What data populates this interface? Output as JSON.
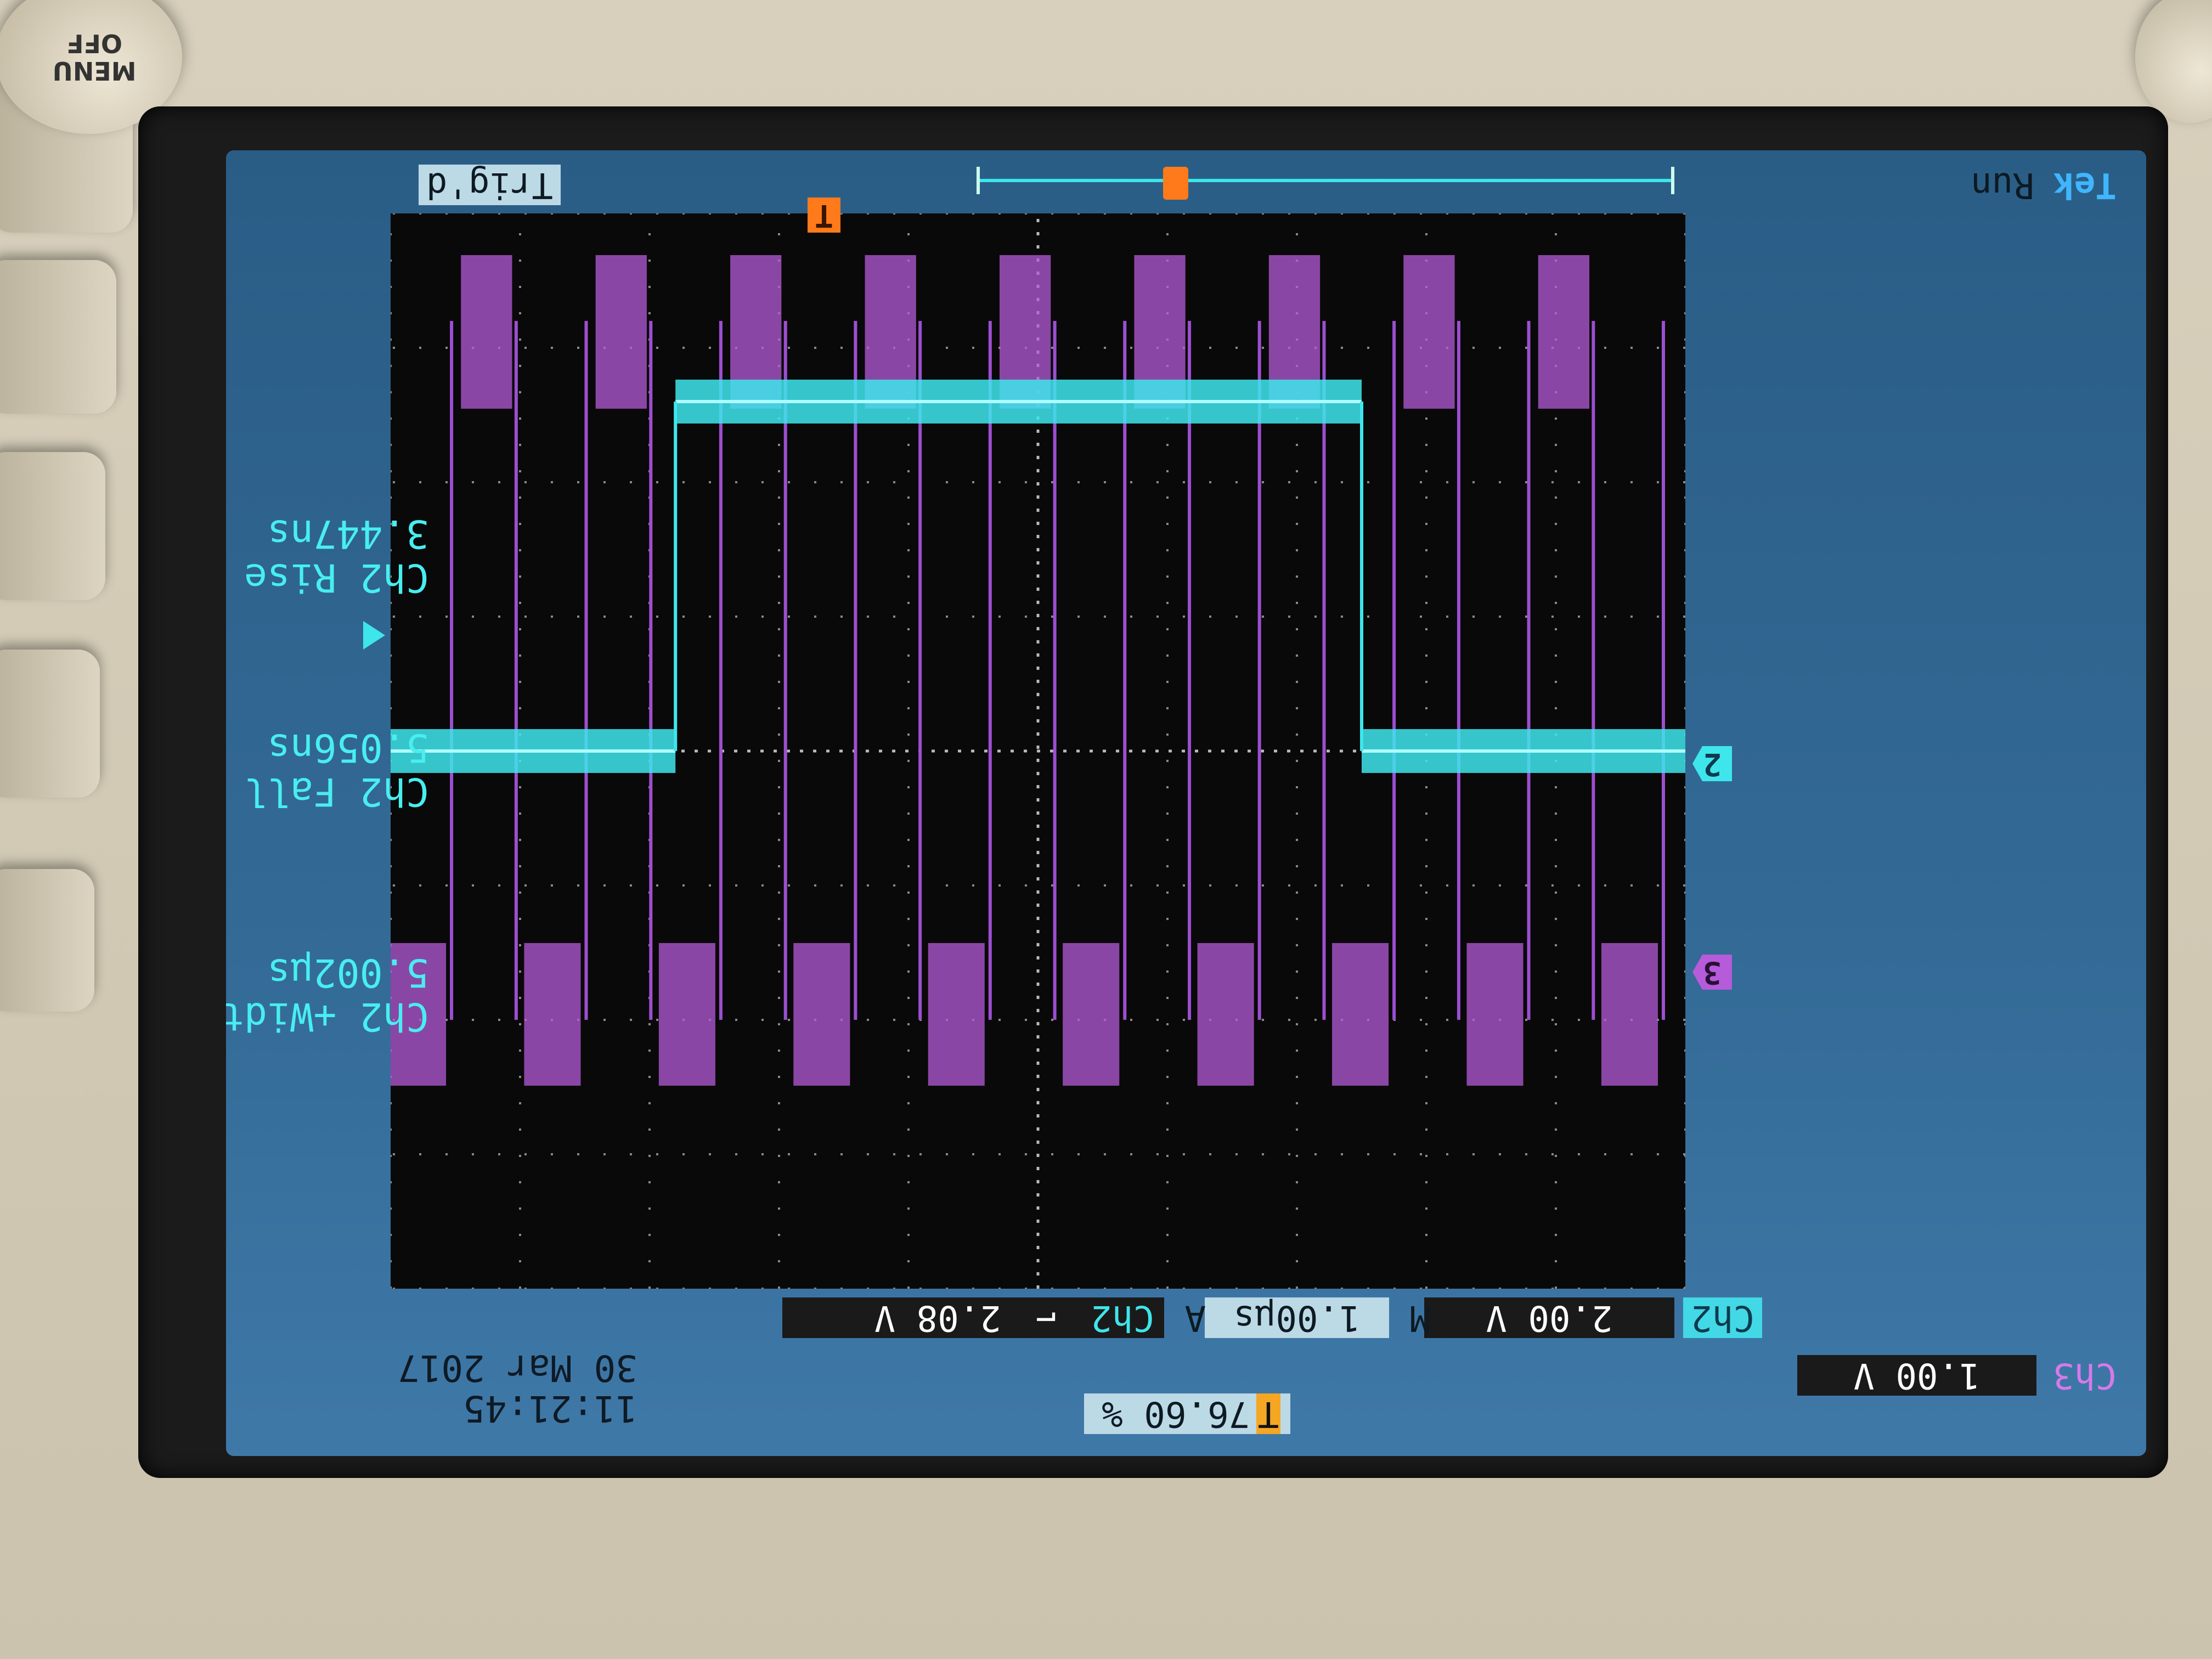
{
  "bezel": {
    "menu_off_label": "MENU\nOFF"
  },
  "header": {
    "date": "30 Mar 2017",
    "time": "11:21:45",
    "trigger_position": "76.60 %",
    "trigger_position_icon": "trigger-T-icon",
    "ch3_label": "Ch3",
    "ch3_scale": "1.00 V",
    "ch2_label": "Ch2",
    "ch2_scale": "2.00 V",
    "timebase_prefix": "M",
    "timebase": "1.00µs",
    "trigger_prefix": "A",
    "trigger_source": "Ch2",
    "trigger_slope_icon": "falling-edge-icon",
    "trigger_level": "2.08 V"
  },
  "measurements": [
    {
      "label": "Ch2 +Width",
      "value": "5.002µs"
    },
    {
      "label": "Ch2 Fall",
      "value": "5.056ns"
    },
    {
      "label": "Ch2 Rise",
      "value": "3.447ns"
    }
  ],
  "markers": {
    "ch3": "3",
    "ch2": "2",
    "trigger": "T"
  },
  "status": {
    "brand": "Tek",
    "run_state": "Run",
    "trigger_state": "Trig'd"
  },
  "colors": {
    "ch2": "#3ee6ec",
    "ch3": "#b65bd9",
    "trigger": "#ff7a1a",
    "screen_bg": "#336a96"
  },
  "chart_data": {
    "type": "line",
    "divisions_x": 10,
    "divisions_y": 8,
    "grid": true,
    "series": [
      {
        "name": "Ch2",
        "segments": [
          {
            "t_div": [
              0,
              2.5
            ],
            "level_div": 0
          },
          {
            "t_div": [
              2.5,
              7.8
            ],
            "level_div": -2.6
          },
          {
            "t_div": [
              7.8,
              10
            ],
            "level_div": 0
          }
        ]
      },
      {
        "name": "Ch3",
        "pulse_period_div": 1.04,
        "high_level_div": 2.0,
        "low_level_div": -3.2
      }
    ]
  }
}
